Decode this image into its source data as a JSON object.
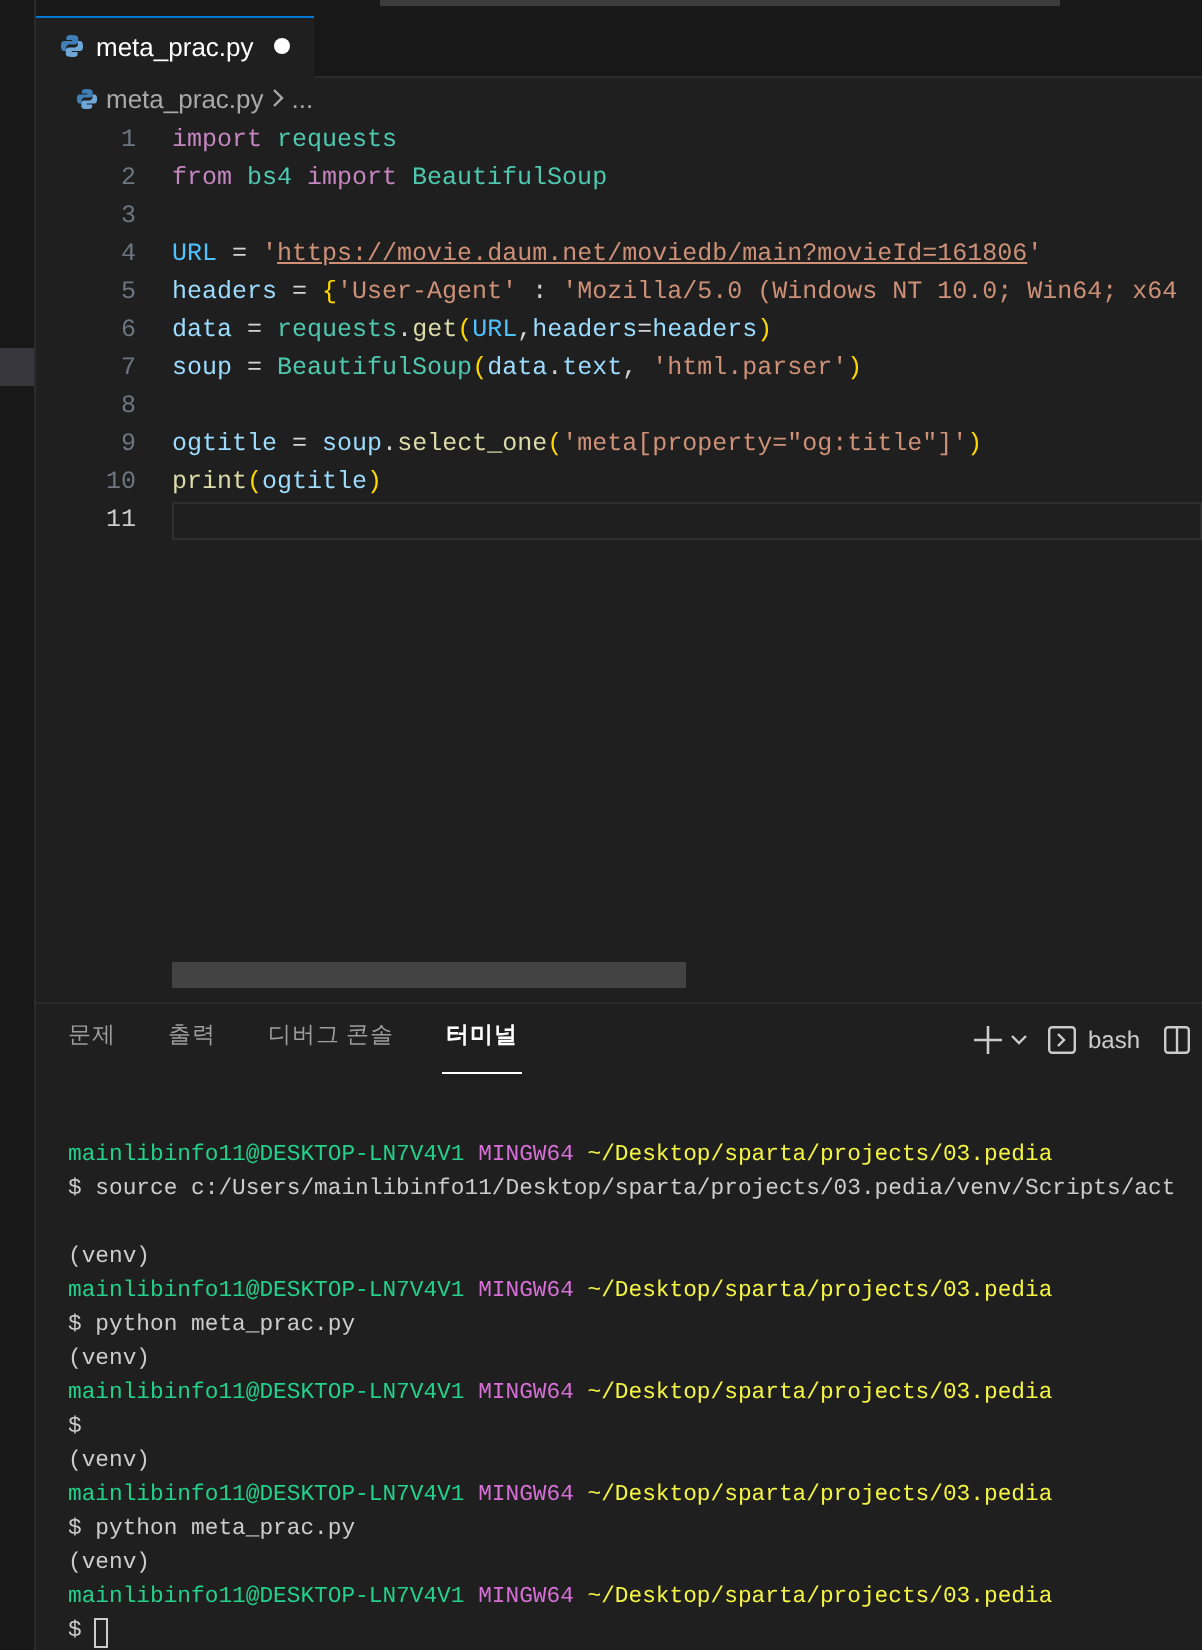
{
  "editor_tab": {
    "label": "meta_prac.py",
    "modified": true,
    "selected": true
  },
  "breadcrumb": {
    "file": "meta_prac.py",
    "more": "..."
  },
  "code_lines": [
    {
      "number": "1",
      "current": false,
      "tokens": [
        {
          "kind": "keyword",
          "text": "import"
        },
        {
          "kind": "module",
          "text": " requests"
        }
      ]
    },
    {
      "number": "2",
      "current": false,
      "tokens": [
        {
          "kind": "keyword",
          "text": "from"
        },
        {
          "kind": "module",
          "text": " bs4"
        },
        {
          "kind": "keyword",
          "text": " import"
        },
        {
          "kind": "module",
          "text": " BeautifulSoup"
        }
      ]
    },
    {
      "number": "3",
      "current": false
    },
    {
      "number": "4",
      "current": false,
      "tokens": [
        {
          "kind": "constant",
          "text": "URL"
        },
        {
          "kind": "plain",
          "text": " = "
        },
        {
          "kind": "string",
          "text": "'"
        },
        {
          "kind": "link",
          "text": "https://movie.daum.net/moviedb/main?movieId=161806"
        },
        {
          "kind": "string",
          "text": "'"
        }
      ]
    },
    {
      "number": "5",
      "current": false,
      "tokens": [
        {
          "kind": "variable",
          "text": "headers"
        },
        {
          "kind": "plain",
          "text": " = "
        },
        {
          "kind": "bracket",
          "text": "{"
        },
        {
          "kind": "string",
          "text": "'User-Agent'"
        },
        {
          "kind": "plain",
          "text": " : "
        },
        {
          "kind": "string",
          "text": "'Mozilla/5.0 (Windows NT 10.0; Win64; x64"
        }
      ]
    },
    {
      "number": "6",
      "current": false,
      "tokens": [
        {
          "kind": "variable",
          "text": "data"
        },
        {
          "kind": "plain",
          "text": " = "
        },
        {
          "kind": "module",
          "text": "requests"
        },
        {
          "kind": "plain",
          "text": "."
        },
        {
          "kind": "function",
          "text": "get"
        },
        {
          "kind": "bracket",
          "text": "("
        },
        {
          "kind": "constant",
          "text": "URL"
        },
        {
          "kind": "plain",
          "text": ","
        },
        {
          "kind": "variable",
          "text": "headers"
        },
        {
          "kind": "plain",
          "text": "="
        },
        {
          "kind": "variable",
          "text": "headers"
        },
        {
          "kind": "bracket",
          "text": ")"
        }
      ]
    },
    {
      "number": "7",
      "current": false,
      "tokens": [
        {
          "kind": "variable",
          "text": "soup"
        },
        {
          "kind": "plain",
          "text": " = "
        },
        {
          "kind": "module",
          "text": "BeautifulSoup"
        },
        {
          "kind": "bracket",
          "text": "("
        },
        {
          "kind": "variable",
          "text": "data"
        },
        {
          "kind": "plain",
          "text": "."
        },
        {
          "kind": "variable",
          "text": "text"
        },
        {
          "kind": "plain",
          "text": ", "
        },
        {
          "kind": "string",
          "text": "'html.parser'"
        },
        {
          "kind": "bracket",
          "text": ")"
        }
      ]
    },
    {
      "number": "8",
      "current": false
    },
    {
      "number": "9",
      "current": false,
      "tokens": [
        {
          "kind": "variable",
          "text": "ogtitle"
        },
        {
          "kind": "plain",
          "text": " = "
        },
        {
          "kind": "variable",
          "text": "soup"
        },
        {
          "kind": "plain",
          "text": "."
        },
        {
          "kind": "function",
          "text": "select_one"
        },
        {
          "kind": "bracket",
          "text": "("
        },
        {
          "kind": "string",
          "text": "'meta[property=\"og:title\"]'"
        },
        {
          "kind": "bracket",
          "text": ")"
        }
      ]
    },
    {
      "number": "10",
      "current": false,
      "tokens": [
        {
          "kind": "function",
          "text": "print"
        },
        {
          "kind": "bracket",
          "text": "("
        },
        {
          "kind": "variable",
          "text": "ogtitle"
        },
        {
          "kind": "bracket",
          "text": ")"
        }
      ]
    },
    {
      "number": "11",
      "current": true
    }
  ],
  "panel_tabs": [
    {
      "label": "문제",
      "selected": false
    },
    {
      "label": "출력",
      "selected": false
    },
    {
      "label": "디버그 콘솔",
      "selected": false
    },
    {
      "label": "터미널",
      "selected": true
    }
  ],
  "terminal_toolbar": {
    "shell": "bash"
  },
  "terminal_lines": [
    {
      "kind": "prompt",
      "user": "mainlibinfo11@DESKTOP-LN7V4V1",
      "system": "MINGW64",
      "path": "~/Desktop/sparta/projects/03.pedia"
    },
    {
      "kind": "text",
      "text": "$ source c:/Users/mainlibinfo11/Desktop/sparta/projects/03.pedia/venv/Scripts/act"
    },
    {
      "kind": "blank"
    },
    {
      "kind": "text",
      "text": "(venv)"
    },
    {
      "kind": "prompt",
      "user": "mainlibinfo11@DESKTOP-LN7V4V1",
      "system": "MINGW64",
      "path": "~/Desktop/sparta/projects/03.pedia"
    },
    {
      "kind": "text",
      "text": "$ python meta_prac.py"
    },
    {
      "kind": "text",
      "text": "(venv)"
    },
    {
      "kind": "prompt",
      "user": "mainlibinfo11@DESKTOP-LN7V4V1",
      "system": "MINGW64",
      "path": "~/Desktop/sparta/projects/03.pedia"
    },
    {
      "kind": "text",
      "text": "$"
    },
    {
      "kind": "text",
      "text": "(venv)"
    },
    {
      "kind": "prompt",
      "user": "mainlibinfo11@DESKTOP-LN7V4V1",
      "system": "MINGW64",
      "path": "~/Desktop/sparta/projects/03.pedia"
    },
    {
      "kind": "text",
      "text": "$ python meta_prac.py"
    },
    {
      "kind": "text",
      "text": "(venv)"
    },
    {
      "kind": "prompt",
      "user": "mainlibinfo11@DESKTOP-LN7V4V1",
      "system": "MINGW64",
      "path": "~/Desktop/sparta/projects/03.pedia"
    },
    {
      "kind": "input",
      "text": "$"
    }
  ]
}
